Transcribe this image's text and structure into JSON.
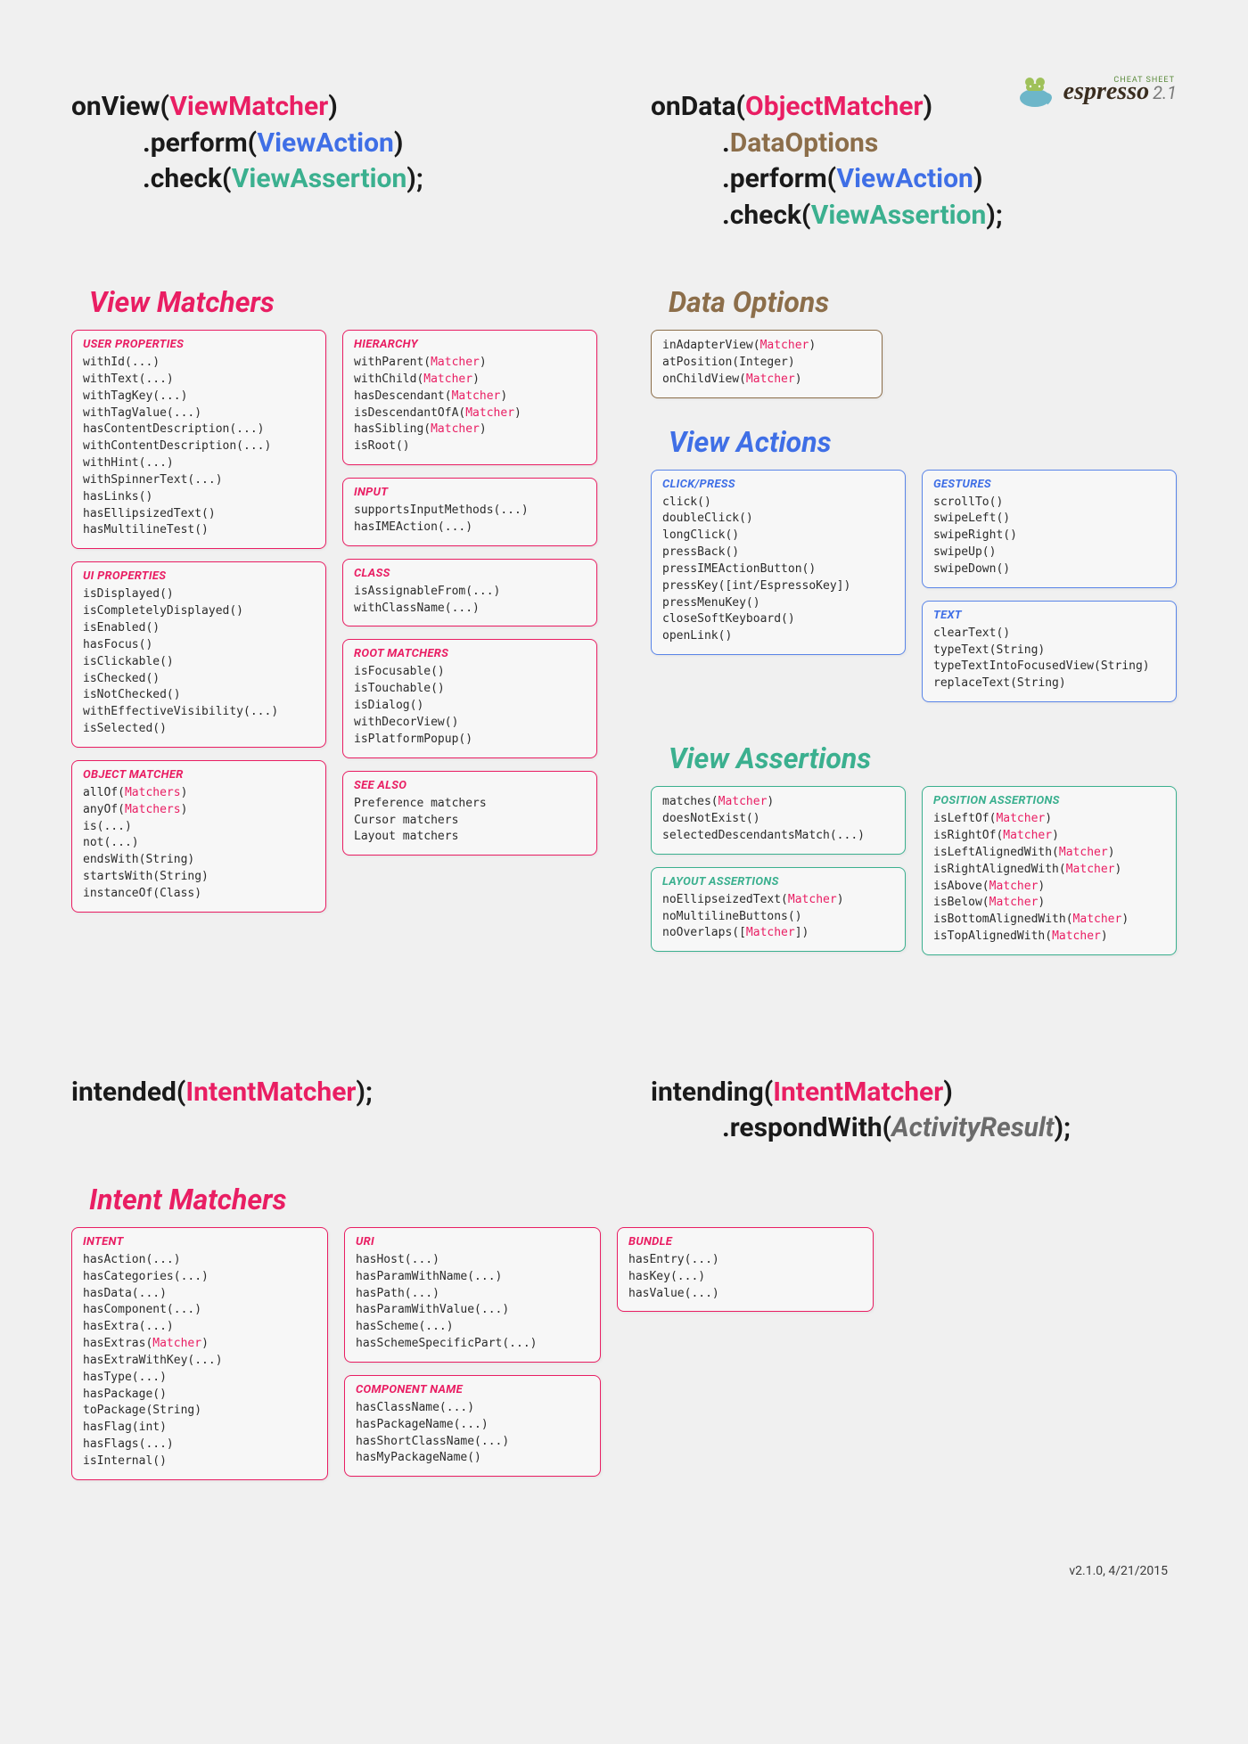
{
  "logo": {
    "cheat": "CHEAT SHEET",
    "name": "espresso",
    "ver": "2.1"
  },
  "footer": "v2.1.0, 4/21/2015",
  "top_left": {
    "l1a": "onView",
    "l1b": "(",
    "l1c": "ViewMatcher",
    "l1d": ")",
    "l2a": ".perform(",
    "l2b": "ViewAction",
    "l2c": ")",
    "l3a": ".check(",
    "l3b": "ViewAssertion",
    "l3c": ");"
  },
  "top_right": {
    "l1a": "onData",
    "l1b": "(",
    "l1c": "ObjectMatcher",
    "l1d": ")",
    "l2a": ".",
    "l2b": "DataOptions",
    "l3a": ".perform(",
    "l3b": "ViewAction",
    "l3c": ")",
    "l4a": ".check(",
    "l4b": "ViewAssertion",
    "l4c": ");"
  },
  "sec_vm": "View Matchers",
  "sec_do": "Data Options",
  "sec_va": "View Actions",
  "sec_vas": "View Assertions",
  "vm": {
    "user_properties": {
      "title": "USER PROPERTIES",
      "items": [
        [
          {
            "t": "withId(...)"
          }
        ],
        [
          {
            "t": "withText(...)"
          }
        ],
        [
          {
            "t": "withTagKey(...)"
          }
        ],
        [
          {
            "t": "withTagValue(...)"
          }
        ],
        [
          {
            "t": "hasContentDescription(...)"
          }
        ],
        [
          {
            "t": "withContentDescription(...)"
          }
        ],
        [
          {
            "t": "withHint(...)"
          }
        ],
        [
          {
            "t": "withSpinnerText(...)"
          }
        ],
        [
          {
            "t": "hasLinks()"
          }
        ],
        [
          {
            "t": "hasEllipsizedText()"
          }
        ],
        [
          {
            "t": "hasMultilineTest()"
          }
        ]
      ]
    },
    "ui_properties": {
      "title": "UI PROPERTIES",
      "items": [
        [
          {
            "t": "isDisplayed()"
          }
        ],
        [
          {
            "t": "isCompletelyDisplayed()"
          }
        ],
        [
          {
            "t": "isEnabled()"
          }
        ],
        [
          {
            "t": "hasFocus()"
          }
        ],
        [
          {
            "t": "isClickable()"
          }
        ],
        [
          {
            "t": "isChecked()"
          }
        ],
        [
          {
            "t": "isNotChecked()"
          }
        ],
        [
          {
            "t": "withEffectiveVisibility(...)"
          }
        ],
        [
          {
            "t": "isSelected()"
          }
        ]
      ]
    },
    "object_matcher": {
      "title": "OBJECT MATCHER",
      "items": [
        [
          {
            "t": "allOf("
          },
          {
            "t": "Matchers",
            "m": true
          },
          {
            "t": ")"
          }
        ],
        [
          {
            "t": "anyOf("
          },
          {
            "t": "Matchers",
            "m": true
          },
          {
            "t": ")"
          }
        ],
        [
          {
            "t": "is(...)"
          }
        ],
        [
          {
            "t": "not(...)"
          }
        ],
        [
          {
            "t": "endsWith(String)"
          }
        ],
        [
          {
            "t": "startsWith(String)"
          }
        ],
        [
          {
            "t": "instanceOf(Class)"
          }
        ]
      ]
    },
    "hierarchy": {
      "title": "HIERARCHY",
      "items": [
        [
          {
            "t": "withParent("
          },
          {
            "t": "Matcher",
            "m": true
          },
          {
            "t": ")"
          }
        ],
        [
          {
            "t": "withChild("
          },
          {
            "t": "Matcher",
            "m": true
          },
          {
            "t": ")"
          }
        ],
        [
          {
            "t": "hasDescendant("
          },
          {
            "t": "Matcher",
            "m": true
          },
          {
            "t": ")"
          }
        ],
        [
          {
            "t": "isDescendantOfA("
          },
          {
            "t": "Matcher",
            "m": true
          },
          {
            "t": ")"
          }
        ],
        [
          {
            "t": "hasSibling("
          },
          {
            "t": "Matcher",
            "m": true
          },
          {
            "t": ")"
          }
        ],
        [
          {
            "t": "isRoot()"
          }
        ]
      ]
    },
    "input": {
      "title": "INPUT",
      "items": [
        [
          {
            "t": "supportsInputMethods(...)"
          }
        ],
        [
          {
            "t": "hasIMEAction(...)"
          }
        ]
      ]
    },
    "class_": {
      "title": "CLASS",
      "items": [
        [
          {
            "t": "isAssignableFrom(...)"
          }
        ],
        [
          {
            "t": "withClassName(...)"
          }
        ]
      ]
    },
    "root_matchers": {
      "title": "ROOT MATCHERS",
      "items": [
        [
          {
            "t": "isFocusable()"
          }
        ],
        [
          {
            "t": "isTouchable()"
          }
        ],
        [
          {
            "t": "isDialog()"
          }
        ],
        [
          {
            "t": "withDecorView()"
          }
        ],
        [
          {
            "t": "isPlatformPopup()"
          }
        ]
      ]
    },
    "see_also": {
      "title": "SEE ALSO",
      "items": [
        [
          {
            "t": "Preference matchers"
          }
        ],
        [
          {
            "t": "Cursor matchers"
          }
        ],
        [
          {
            "t": "Layout matchers"
          }
        ]
      ]
    }
  },
  "do_card": {
    "items": [
      [
        {
          "t": "inAdapterView("
        },
        {
          "t": "Matcher",
          "m": true
        },
        {
          "t": ")"
        }
      ],
      [
        {
          "t": "atPosition(Integer)"
        }
      ],
      [
        {
          "t": "onChildView("
        },
        {
          "t": "Matcher",
          "m": true
        },
        {
          "t": ")"
        }
      ]
    ]
  },
  "va": {
    "click_press": {
      "title": "CLICK/PRESS",
      "items": [
        [
          {
            "t": "click()"
          }
        ],
        [
          {
            "t": "doubleClick()"
          }
        ],
        [
          {
            "t": "longClick()"
          }
        ],
        [
          {
            "t": "pressBack()"
          }
        ],
        [
          {
            "t": "pressIMEActionButton()"
          }
        ],
        [
          {
            "t": "pressKey([int/EspressoKey])"
          }
        ],
        [
          {
            "t": "pressMenuKey()"
          }
        ],
        [
          {
            "t": "closeSoftKeyboard()"
          }
        ],
        [
          {
            "t": "openLink()"
          }
        ]
      ]
    },
    "gestures": {
      "title": "GESTURES",
      "items": [
        [
          {
            "t": "scrollTo()"
          }
        ],
        [
          {
            "t": "swipeLeft()"
          }
        ],
        [
          {
            "t": "swipeRight()"
          }
        ],
        [
          {
            "t": "swipeUp()"
          }
        ],
        [
          {
            "t": "swipeDown()"
          }
        ]
      ]
    },
    "text": {
      "title": "TEXT",
      "items": [
        [
          {
            "t": "clearText()"
          }
        ],
        [
          {
            "t": "typeText(String)"
          }
        ],
        [
          {
            "t": "typeTextIntoFocusedView(String)"
          }
        ],
        [
          {
            "t": "replaceText(String)"
          }
        ]
      ]
    }
  },
  "vas": {
    "main": {
      "items": [
        [
          {
            "t": "matches("
          },
          {
            "t": "Matcher",
            "m": true
          },
          {
            "t": ")"
          }
        ],
        [
          {
            "t": "doesNotExist()"
          }
        ],
        [
          {
            "t": "selectedDescendantsMatch(...)"
          }
        ]
      ]
    },
    "layout": {
      "title": "LAYOUT ASSERTIONS",
      "items": [
        [
          {
            "t": "noEllipseizedText("
          },
          {
            "t": "Matcher",
            "m": true
          },
          {
            "t": ")"
          }
        ],
        [
          {
            "t": "noMultilineButtons()"
          }
        ],
        [
          {
            "t": "noOverlaps(["
          },
          {
            "t": "Matcher",
            "m": true
          },
          {
            "t": "])"
          }
        ]
      ]
    },
    "position": {
      "title": "POSITION ASSERTIONS",
      "items": [
        [
          {
            "t": "isLeftOf("
          },
          {
            "t": "Matcher",
            "m": true
          },
          {
            "t": ")"
          }
        ],
        [
          {
            "t": "isRightOf("
          },
          {
            "t": "Matcher",
            "m": true
          },
          {
            "t": ")"
          }
        ],
        [
          {
            "t": "isLeftAlignedWith("
          },
          {
            "t": "Matcher",
            "m": true
          },
          {
            "t": ")"
          }
        ],
        [
          {
            "t": "isRightAlignedWith("
          },
          {
            "t": "Matcher",
            "m": true
          },
          {
            "t": ")"
          }
        ],
        [
          {
            "t": "isAbove("
          },
          {
            "t": "Matcher",
            "m": true
          },
          {
            "t": ")"
          }
        ],
        [
          {
            "t": "isBelow("
          },
          {
            "t": "Matcher",
            "m": true
          },
          {
            "t": ")"
          }
        ],
        [
          {
            "t": "isBottomAlignedWith("
          },
          {
            "t": "Matcher",
            "m": true
          },
          {
            "t": ")"
          }
        ],
        [
          {
            "t": "isTopAlignedWith("
          },
          {
            "t": "Matcher",
            "m": true
          },
          {
            "t": ")"
          }
        ]
      ]
    }
  },
  "bot_left": {
    "l1a": "intended",
    "l1b": "(",
    "l1c": "IntentMatcher",
    "l1d": ");"
  },
  "bot_right": {
    "l1a": "intending",
    "l1b": "(",
    "l1c": "IntentMatcher",
    "l1d": ")",
    "l2a": ".respondWith(",
    "l2b": "ActivityResult",
    "l2c": ");"
  },
  "sec_im": "Intent Matchers",
  "im": {
    "intent": {
      "title": "INTENT",
      "items": [
        [
          {
            "t": "hasAction(...)"
          }
        ],
        [
          {
            "t": "hasCategories(...)"
          }
        ],
        [
          {
            "t": "hasData(...)"
          }
        ],
        [
          {
            "t": "hasComponent(...)"
          }
        ],
        [
          {
            "t": "hasExtra(...)"
          }
        ],
        [
          {
            "t": "hasExtras("
          },
          {
            "t": "Matcher",
            "m": true
          },
          {
            "t": ")"
          }
        ],
        [
          {
            "t": "hasExtraWithKey(...)"
          }
        ],
        [
          {
            "t": "hasType(...)"
          }
        ],
        [
          {
            "t": "hasPackage()"
          }
        ],
        [
          {
            "t": "toPackage(String)"
          }
        ],
        [
          {
            "t": "hasFlag(int)"
          }
        ],
        [
          {
            "t": "hasFlags(...)"
          }
        ],
        [
          {
            "t": "isInternal()"
          }
        ]
      ]
    },
    "uri": {
      "title": "URI",
      "items": [
        [
          {
            "t": "hasHost(...)"
          }
        ],
        [
          {
            "t": "hasParamWithName(...)"
          }
        ],
        [
          {
            "t": "hasPath(...)"
          }
        ],
        [
          {
            "t": "hasParamWithValue(...)"
          }
        ],
        [
          {
            "t": "hasScheme(...)"
          }
        ],
        [
          {
            "t": "hasSchemeSpecificPart(...)"
          }
        ]
      ]
    },
    "component_name": {
      "title": "COMPONENT NAME",
      "items": [
        [
          {
            "t": "hasClassName(...)"
          }
        ],
        [
          {
            "t": "hasPackageName(...)"
          }
        ],
        [
          {
            "t": "hasShortClassName(...)"
          }
        ],
        [
          {
            "t": "hasMyPackageName()"
          }
        ]
      ]
    },
    "bundle": {
      "title": "BUNDLE",
      "items": [
        [
          {
            "t": "hasEntry(...)"
          }
        ],
        [
          {
            "t": "hasKey(...)"
          }
        ],
        [
          {
            "t": "hasValue(...)"
          }
        ]
      ]
    }
  }
}
